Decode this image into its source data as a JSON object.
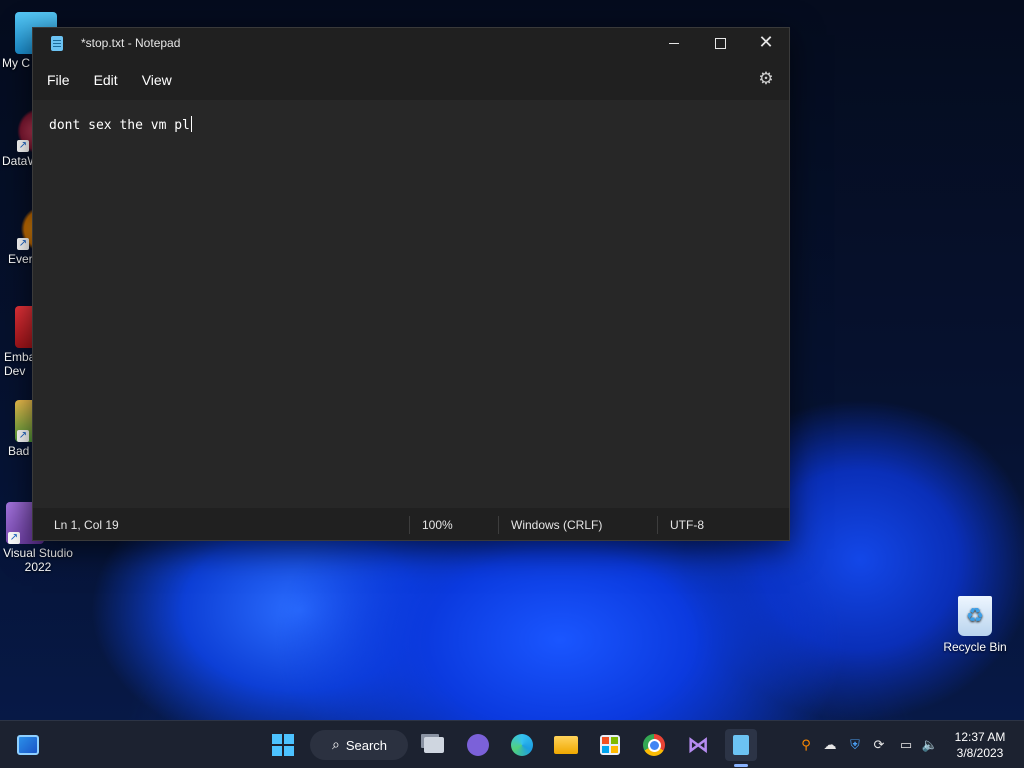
{
  "desktop": {
    "icons": [
      {
        "label": "My C"
      },
      {
        "label": "DataW"
      },
      {
        "label": "Ever"
      },
      {
        "label": "Emba\nDev"
      },
      {
        "label": "Bad"
      },
      {
        "label": "Visual Studio\n2022"
      }
    ],
    "recycle_bin": {
      "label": "Recycle Bin"
    }
  },
  "notepad": {
    "title": "*stop.txt - Notepad",
    "menu": {
      "file": "File",
      "edit": "Edit",
      "view": "View"
    },
    "content": "dont sex the vm pl",
    "status": {
      "position": "Ln 1, Col 19",
      "zoom": "100%",
      "line_ending": "Windows (CRLF)",
      "encoding": "UTF-8"
    }
  },
  "taskbar": {
    "search_label": "Search",
    "clock": {
      "time": "12:37 AM",
      "date": "3/8/2023"
    }
  },
  "colors": {
    "window_bg": "#202020",
    "editor_bg": "#272727",
    "taskbar_bg": "#1c2230",
    "accent": "#6cc3f3"
  }
}
